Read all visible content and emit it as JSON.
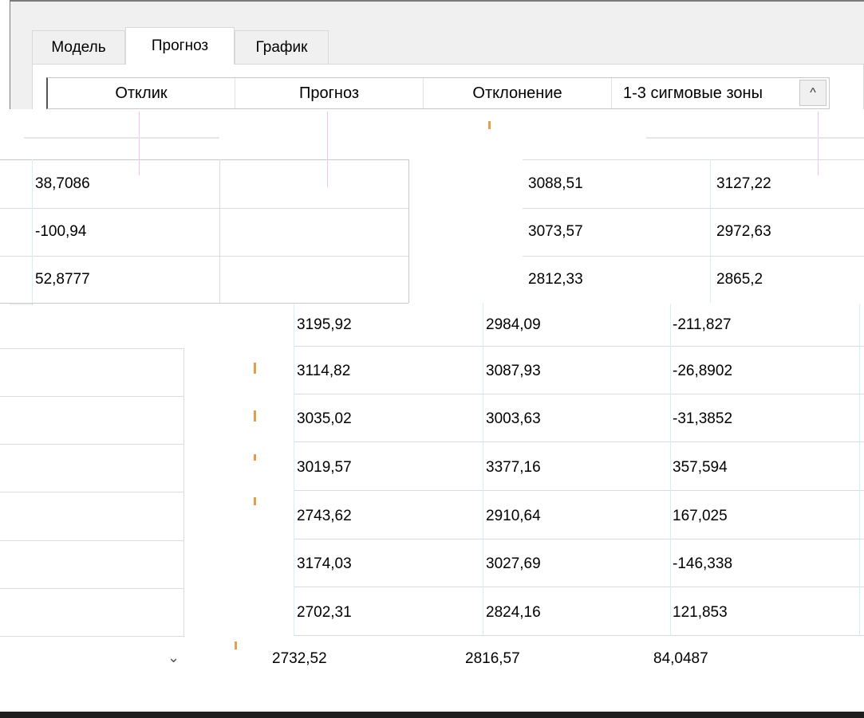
{
  "tabs": [
    {
      "label": "Модель"
    },
    {
      "label": "Прогноз"
    },
    {
      "label": "График"
    }
  ],
  "columns": [
    {
      "label": "Отклик"
    },
    {
      "label": "Прогноз"
    },
    {
      "label": "Отклонение"
    },
    {
      "label": "1-3 сигмовые зоны"
    }
  ],
  "scroll_up_glyph": "^",
  "scroll_down_glyph": "⌄",
  "left_values": [
    "38,7086",
    "-100,94",
    "52,8777"
  ],
  "right_values": [
    [
      "3088,51",
      "3127,22"
    ],
    [
      "3073,57",
      "2972,63"
    ],
    [
      "2812,33",
      "2865,2"
    ]
  ],
  "rows": [
    [
      "3195,92",
      "2984,09",
      "-211,827"
    ],
    [
      "3114,82",
      "3087,93",
      "-26,8902"
    ],
    [
      "3035,02",
      "3003,63",
      "-31,3852"
    ],
    [
      "3019,57",
      "3377,16",
      "357,594"
    ],
    [
      "2743,62",
      "2910,64",
      "167,025"
    ],
    [
      "3174,03",
      "3027,69",
      "-146,338"
    ],
    [
      "2702,31",
      "2824,16",
      "121,853"
    ],
    [
      "2732,52",
      "2816,57",
      "84,0487"
    ]
  ]
}
